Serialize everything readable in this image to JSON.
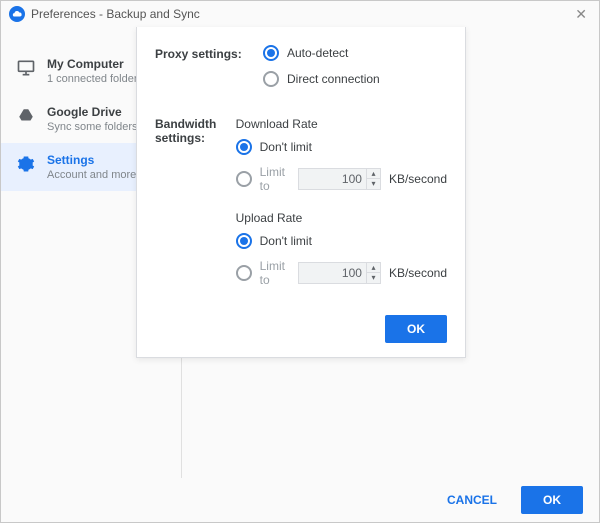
{
  "window": {
    "title": "Preferences - Backup and Sync"
  },
  "sidebar": {
    "items": [
      {
        "title": "My Computer",
        "sub": "1 connected folder"
      },
      {
        "title": "Google Drive",
        "sub": "Sync some folders"
      },
      {
        "title": "Settings",
        "sub": "Account and more"
      }
    ]
  },
  "panel": {
    "proxy": {
      "label": "Proxy settings:",
      "auto": "Auto-detect",
      "direct": "Direct connection",
      "selected": "auto"
    },
    "bandwidth": {
      "label": "Bandwidth settings:",
      "download": {
        "title": "Download Rate",
        "dont_limit": "Don't limit",
        "limit_to": "Limit to",
        "value": "100",
        "unit": "KB/second",
        "selected": "dont"
      },
      "upload": {
        "title": "Upload Rate",
        "dont_limit": "Don't limit",
        "limit_to": "Limit to",
        "value": "100",
        "unit": "KB/second",
        "selected": "dont"
      }
    },
    "ok": "OK"
  },
  "footer": {
    "cancel": "CANCEL",
    "ok": "OK"
  }
}
